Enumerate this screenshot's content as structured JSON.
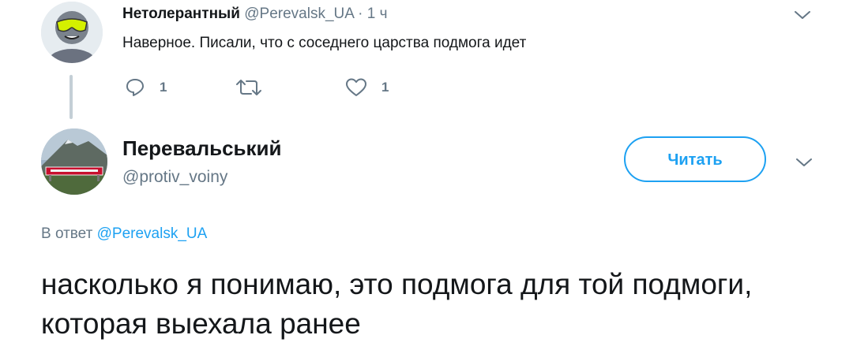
{
  "parent_tweet": {
    "author_name": "Нетолерантный",
    "author_handle": "@Perevalsk_UA",
    "separator": "·",
    "time": "1 ч",
    "text": "Наверное. Писали, что с соседнего царства подмога идет",
    "reply_count": "1",
    "like_count": "1",
    "icons": [
      "avatar-sunglasses-face",
      "chevron-down-icon",
      "reply-icon",
      "retweet-icon",
      "like-icon"
    ]
  },
  "main_tweet": {
    "author_name": "Перевальський",
    "author_handle": "@protiv_voiny",
    "follow_label": "Читать",
    "reply_prefix": "В ответ",
    "reply_mention": "@Perevalsk_UA",
    "text": "насколько я понимаю, это подмога для той подмоги, которая выехала ранее",
    "icons": [
      "avatar-landscape-sign",
      "chevron-down-icon"
    ]
  },
  "colors": {
    "accent": "#1da1f2",
    "secondary_text": "#657786",
    "primary_text": "#14171a",
    "thread_line": "#c4cfd6"
  }
}
